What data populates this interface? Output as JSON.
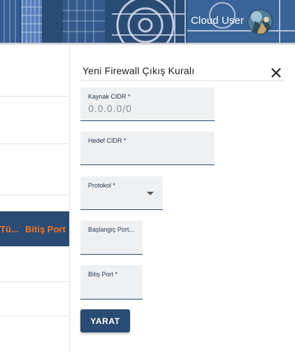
{
  "header": {
    "user_name": "Cloud User",
    "colors": {
      "banner": "#2a4b73",
      "accent": "#f27421"
    }
  },
  "background_table": {
    "columns": [
      "Tü...",
      "Bitiş Port"
    ]
  },
  "panel": {
    "title": "Yeni Firewall Çıkış Kuralı",
    "fields": {
      "source_cidr": {
        "label": "Kaynak CIDR *",
        "value": "0.0.0.0/0"
      },
      "destination_cidr": {
        "label": "Hedef CIDR *",
        "value": ""
      },
      "protocol": {
        "label": "Protokol *",
        "value": ""
      },
      "start_port": {
        "label": "Başlangıç Port...",
        "value": ""
      },
      "end_port": {
        "label": "Bitiş Port *",
        "value": ""
      }
    },
    "submit_label": "YARAT"
  }
}
